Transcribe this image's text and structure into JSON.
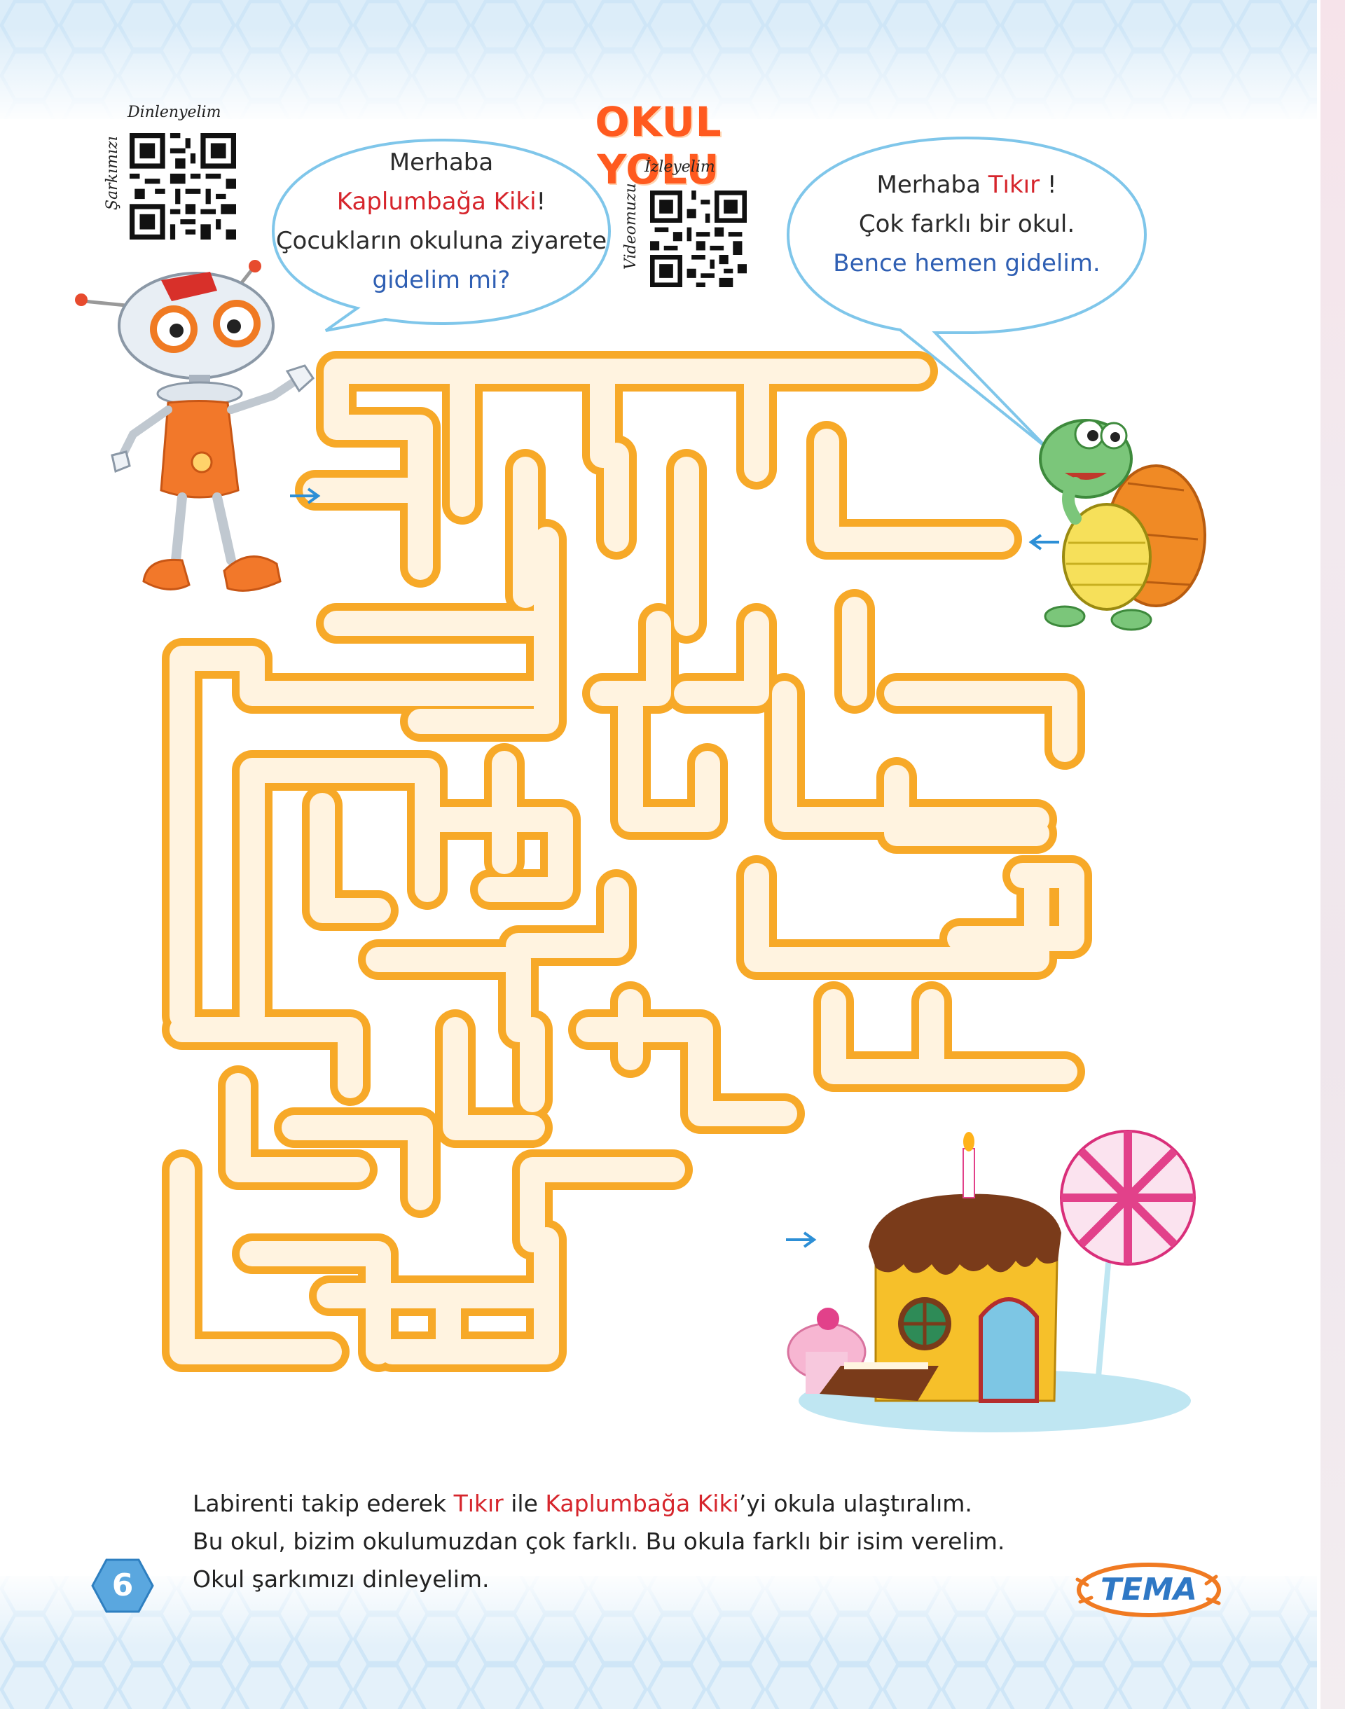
{
  "title": "OKUL YOLU",
  "qr_codes": [
    {
      "top_label": "Dinlenyelim",
      "side_label": "Şarkımızı"
    },
    {
      "top_label": "İzleyelim",
      "side_label": "Videomuzu"
    }
  ],
  "speech_left": {
    "line1": "Merhaba",
    "line2_red": "Kaplumbağa Kiki",
    "line2_rest": "!",
    "line3": "Çocukların okuluna ziyarete",
    "line4_blue": "gidelim mi?"
  },
  "speech_right": {
    "line1_start": "Merhaba ",
    "line1_red": "Tıkır",
    "line1_end": " !",
    "line2": "Çok farklı bir okul.",
    "line3_blue": "Bence hemen gidelim."
  },
  "instructions": {
    "l1_a": "Labirenti takip ederek ",
    "l1_red1": "Tıkır",
    "l1_b": " ile ",
    "l1_red2": "Kaplumbağa Kiki",
    "l1_c": "’yi okula ulaştıralım.",
    "l2": "Bu okul, bizim okulumuzdan çok farklı. Bu okula farklı bir isim verelim.",
    "l3": "Okul şarkımızı dinleyelim."
  },
  "page_number": "6",
  "badge": "TEMA",
  "colors": {
    "title": "#ff5a1f",
    "maze_stroke": "#f7a928",
    "maze_fill": "#fff3e0",
    "highlight_red": "#d6252c",
    "highlight_blue": "#2f5fb3",
    "hex": "#c9e4f6"
  },
  "icons": [
    "robot-tikir",
    "turtle-kiki",
    "cake-house",
    "lollipop",
    "qr-code",
    "arrow-right",
    "arrow-left"
  ]
}
